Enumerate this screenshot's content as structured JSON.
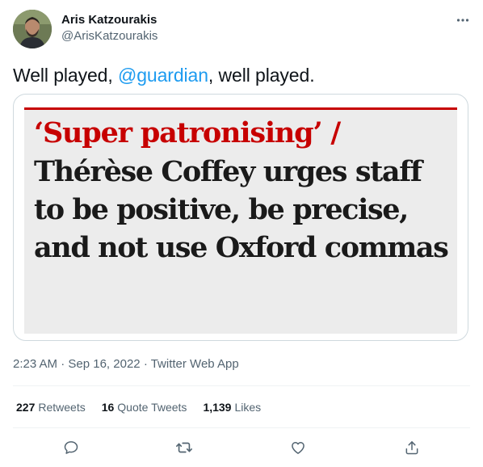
{
  "author": {
    "name": "Aris Katzourakis",
    "handle": "@ArisKatzourakis"
  },
  "tweet": {
    "text_before": "Well played, ",
    "mention": "@guardian",
    "text_after": ", well played."
  },
  "media": {
    "kicker": "‘Super patronising’ /",
    "headline": "Thérèse Coffey urges staff to be positive, be precise, and not use Oxford commas"
  },
  "meta": {
    "time": "2:23 AM",
    "date": "Sep 16, 2022",
    "separator": "·",
    "client": "Twitter Web App"
  },
  "stats": {
    "retweets_count": "227",
    "retweets_label": "Retweets",
    "quotes_count": "16",
    "quotes_label": "Quote Tweets",
    "likes_count": "1,139",
    "likes_label": "Likes"
  },
  "colors": {
    "accent": "#1d9bf0",
    "guardian_red": "#c70000",
    "secondary_text": "#536471"
  },
  "icons": {
    "more": "more-horizontal-icon",
    "reply": "reply-icon",
    "retweet": "retweet-icon",
    "like": "heart-icon",
    "share": "share-icon"
  }
}
